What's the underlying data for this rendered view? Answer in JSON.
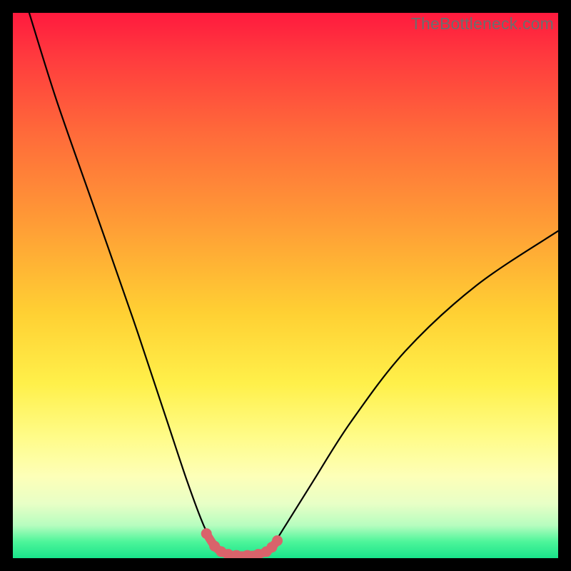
{
  "watermark": {
    "text": "TheBottleneck.com"
  },
  "colors": {
    "frame_bg": "#000000",
    "gradient_top": "#ff1a3e",
    "gradient_mid": "#fff04a",
    "gradient_bottom": "#19e38a",
    "curve": "#000000",
    "marker": "#d9636b"
  },
  "chart_data": {
    "type": "line",
    "title": "",
    "xlabel": "",
    "ylabel": "",
    "xlim": [
      0,
      100
    ],
    "ylim": [
      0,
      100
    ],
    "grid": false,
    "legend": false,
    "series": [
      {
        "name": "bottleneck-curve",
        "x": [
          3,
          8,
          15,
          22,
          28,
          32,
          35,
          37,
          39,
          40,
          42,
          44,
          46,
          48,
          50,
          55,
          62,
          72,
          85,
          100
        ],
        "y": [
          100,
          84,
          64,
          44,
          26,
          14,
          6,
          2.5,
          1,
          0.5,
          0.5,
          0.8,
          1.5,
          3,
          6,
          14,
          25,
          38,
          50,
          60
        ]
      }
    ],
    "markers": {
      "name": "optimal-range",
      "x": [
        35.5,
        37,
        38.2,
        39.5,
        41,
        43,
        45,
        46.5,
        47.5,
        48.5
      ],
      "y": [
        4.5,
        2.2,
        1.2,
        0.7,
        0.5,
        0.5,
        0.7,
        1.2,
        2.0,
        3.2
      ]
    },
    "annotations": []
  }
}
